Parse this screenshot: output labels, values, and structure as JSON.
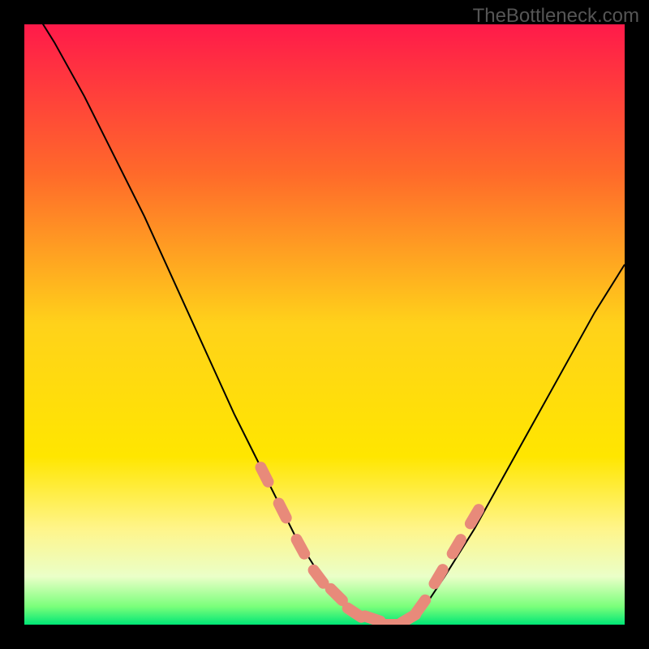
{
  "watermark": "TheBottleneck.com",
  "chart_data": {
    "type": "line",
    "title": "",
    "xlabel": "",
    "ylabel": "",
    "xlim": [
      0,
      100
    ],
    "ylim": [
      0,
      100
    ],
    "grid": false,
    "legend": false,
    "background_gradient": {
      "stops": [
        {
          "offset": 0.0,
          "color": "#ff1a4a"
        },
        {
          "offset": 0.25,
          "color": "#ff6a2a"
        },
        {
          "offset": 0.5,
          "color": "#ffd21a"
        },
        {
          "offset": 0.72,
          "color": "#ffe600"
        },
        {
          "offset": 0.84,
          "color": "#fff58a"
        },
        {
          "offset": 0.92,
          "color": "#eaffc8"
        },
        {
          "offset": 0.97,
          "color": "#7aff7a"
        },
        {
          "offset": 1.0,
          "color": "#00e676"
        }
      ]
    },
    "series": [
      {
        "name": "curve",
        "stroke": "#000000",
        "stroke_width": 2,
        "x": [
          0,
          5,
          10,
          15,
          20,
          25,
          30,
          35,
          40,
          45,
          50,
          55,
          60,
          63,
          66,
          70,
          75,
          80,
          85,
          90,
          95,
          100
        ],
        "values": [
          105,
          97,
          88,
          78,
          68,
          57,
          46,
          35,
          25,
          15,
          7,
          2,
          0,
          0,
          2,
          8,
          16,
          25,
          34,
          43,
          52,
          60
        ]
      }
    ],
    "highlighted_points": {
      "name": "markers",
      "color": "#e88a7a",
      "radius": 7,
      "x": [
        40,
        43,
        46,
        49,
        52,
        55,
        58,
        61,
        64,
        66,
        69,
        72,
        75
      ],
      "values": [
        25,
        19,
        13,
        8,
        5,
        2,
        1,
        0,
        1,
        3,
        8,
        13,
        18
      ]
    }
  }
}
